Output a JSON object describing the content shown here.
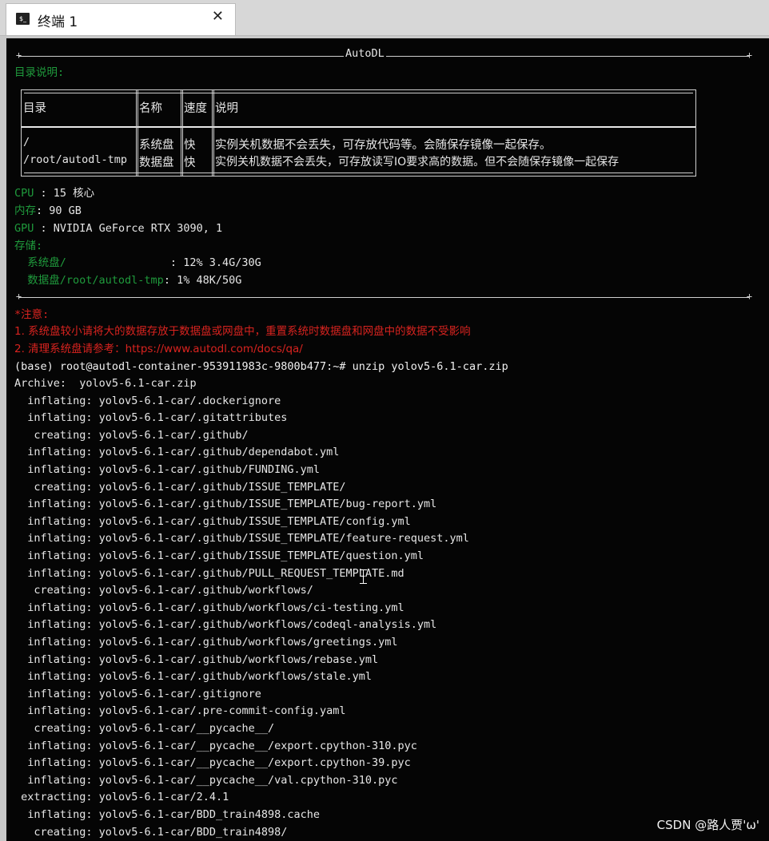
{
  "tab": {
    "icon": "terminal-icon",
    "title": "终端 1",
    "close": "✕"
  },
  "banner": {
    "label": "AutoDL",
    "dir_title": "目录说明:",
    "table": {
      "headers": [
        "目录",
        "名称",
        "速度",
        "说明"
      ],
      "rows": [
        [
          "/",
          "系统盘",
          "快",
          "实例关机数据不会丢失，可存放代码等。会随保存镜像一起保存。"
        ],
        [
          "/root/autodl-tmp",
          "数据盘",
          "快",
          "实例关机数据不会丢失，可存放读写IO要求高的数据。但不会随保存镜像一起保存"
        ]
      ]
    },
    "specs": [
      {
        "key": "CPU",
        "sep": " : ",
        "value": "15 核心"
      },
      {
        "key": "内存",
        "sep": ": ",
        "value": "90 GB"
      },
      {
        "key": "GPU",
        "sep": " : ",
        "value": "NVIDIA GeForce RTX 3090, 1"
      }
    ],
    "storage_title": "存储:",
    "storage": [
      {
        "key": "  系统盘/",
        "value": "                : 12% 3.4G/30G"
      },
      {
        "key": "  数据盘/root/autodl-tmp",
        "value": ": 1% 48K/50G"
      }
    ],
    "notice_title": "*注意:",
    "notices": [
      "1. 系统盘较小请将大的数据存放于数据盘或网盘中，重置系统时数据盘和网盘中的数据不受影响",
      "2. 清理系统盘请参考：https://www.autodl.com/docs/qa/"
    ]
  },
  "prompt": {
    "text": "(base) root@autodl-container-953911983c-9800b477:~# ",
    "command": "unzip yolov5-6.1-car.zip"
  },
  "output": [
    "Archive:  yolov5-6.1-car.zip",
    "  inflating: yolov5-6.1-car/.dockerignore",
    "  inflating: yolov5-6.1-car/.gitattributes",
    "   creating: yolov5-6.1-car/.github/",
    "  inflating: yolov5-6.1-car/.github/dependabot.yml",
    "  inflating: yolov5-6.1-car/.github/FUNDING.yml",
    "   creating: yolov5-6.1-car/.github/ISSUE_TEMPLATE/",
    "  inflating: yolov5-6.1-car/.github/ISSUE_TEMPLATE/bug-report.yml",
    "  inflating: yolov5-6.1-car/.github/ISSUE_TEMPLATE/config.yml",
    "  inflating: yolov5-6.1-car/.github/ISSUE_TEMPLATE/feature-request.yml",
    "  inflating: yolov5-6.1-car/.github/ISSUE_TEMPLATE/question.yml",
    "  inflating: yolov5-6.1-car/.github/PULL_REQUEST_TEMPLATE.md",
    "   creating: yolov5-6.1-car/.github/workflows/",
    "  inflating: yolov5-6.1-car/.github/workflows/ci-testing.yml",
    "  inflating: yolov5-6.1-car/.github/workflows/codeql-analysis.yml",
    "  inflating: yolov5-6.1-car/.github/workflows/greetings.yml",
    "  inflating: yolov5-6.1-car/.github/workflows/rebase.yml",
    "  inflating: yolov5-6.1-car/.github/workflows/stale.yml",
    "  inflating: yolov5-6.1-car/.gitignore",
    "  inflating: yolov5-6.1-car/.pre-commit-config.yaml",
    "   creating: yolov5-6.1-car/__pycache__/",
    "  inflating: yolov5-6.1-car/__pycache__/export.cpython-310.pyc",
    "  inflating: yolov5-6.1-car/__pycache__/export.cpython-39.pyc",
    "  inflating: yolov5-6.1-car/__pycache__/val.cpython-310.pyc",
    " extracting: yolov5-6.1-car/2.4.1",
    "  inflating: yolov5-6.1-car/BDD_train4898.cache",
    "   creating: yolov5-6.1-car/BDD_train4898/"
  ],
  "watermark": "CSDN @路人贾'ω'"
}
